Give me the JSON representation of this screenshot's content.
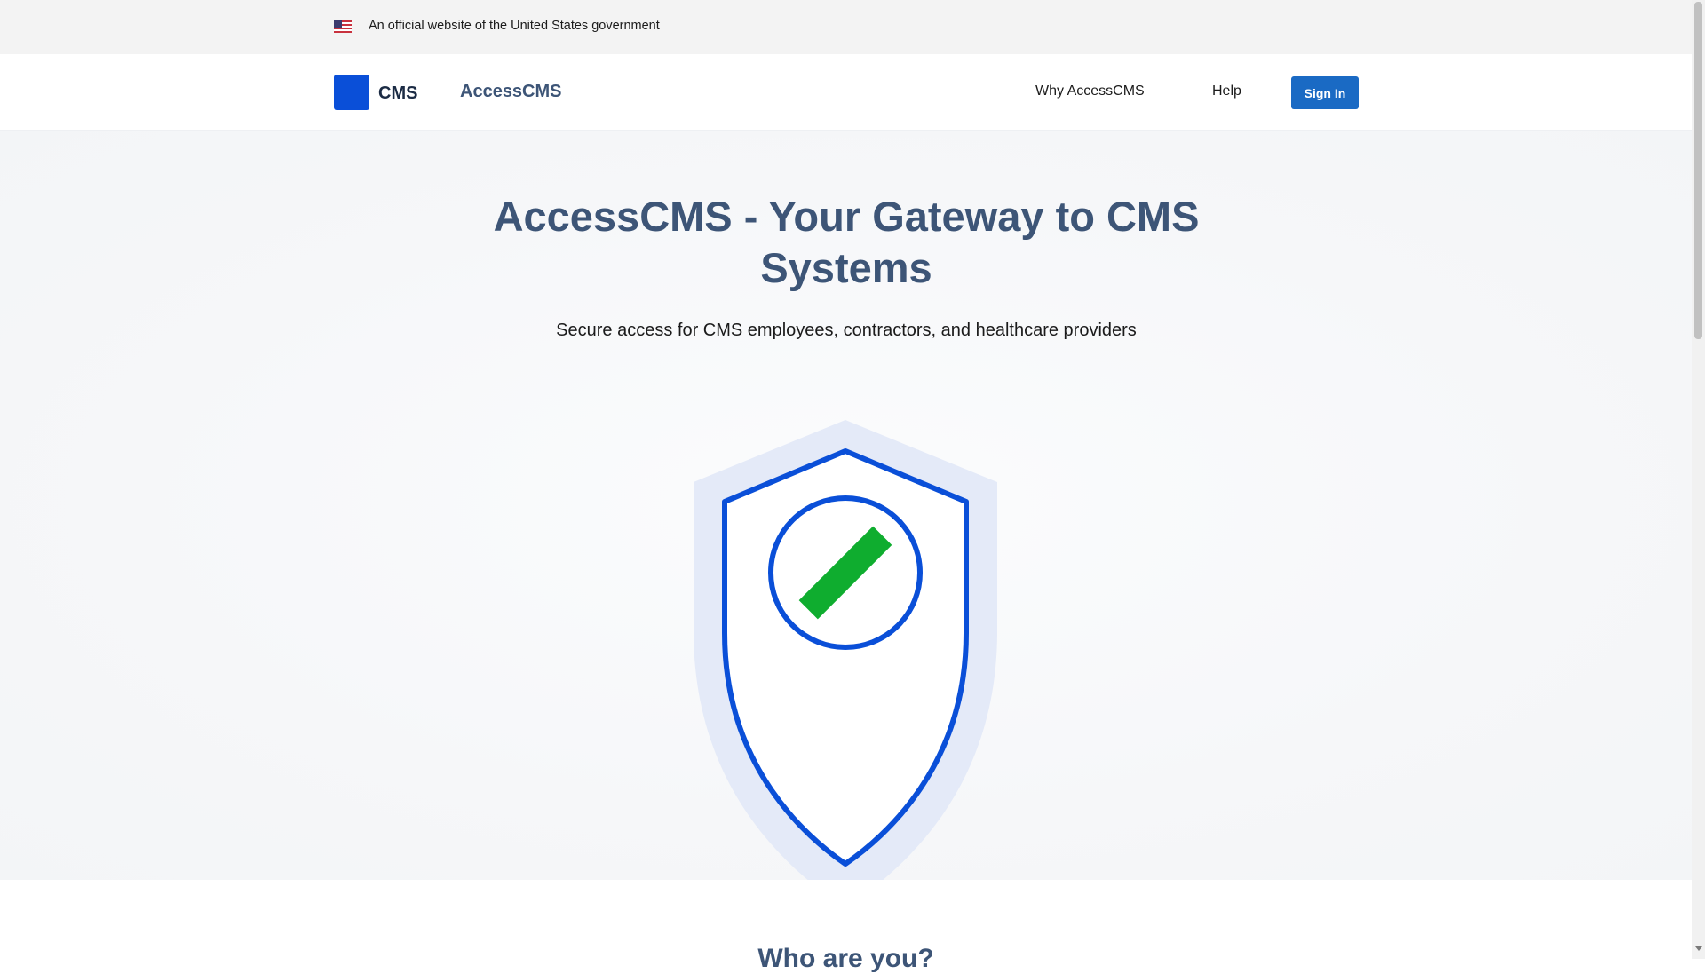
{
  "gov_banner": {
    "text": "An official website of the United States government",
    "flag_icon": "us-flag-icon"
  },
  "header": {
    "logo_text": "CMS",
    "site_name": "AccessCMS",
    "nav": {
      "why": "Why AccessCMS",
      "help": "Help"
    },
    "signin_label": "Sign In"
  },
  "hero": {
    "title": "AccessCMS - Your Gateway to CMS Systems",
    "subtitle": "Secure access for CMS employees, contractors, and healthcare providers",
    "illustration_icon": "shield-check-icon"
  },
  "section2": {
    "title": "Who are you?"
  },
  "colors": {
    "brand_blue": "#0a4fd8",
    "button_blue": "#1a6ac4",
    "heading": "#3d5577",
    "check_green": "#0fad2f",
    "shield_light": "#e4eaf8"
  }
}
